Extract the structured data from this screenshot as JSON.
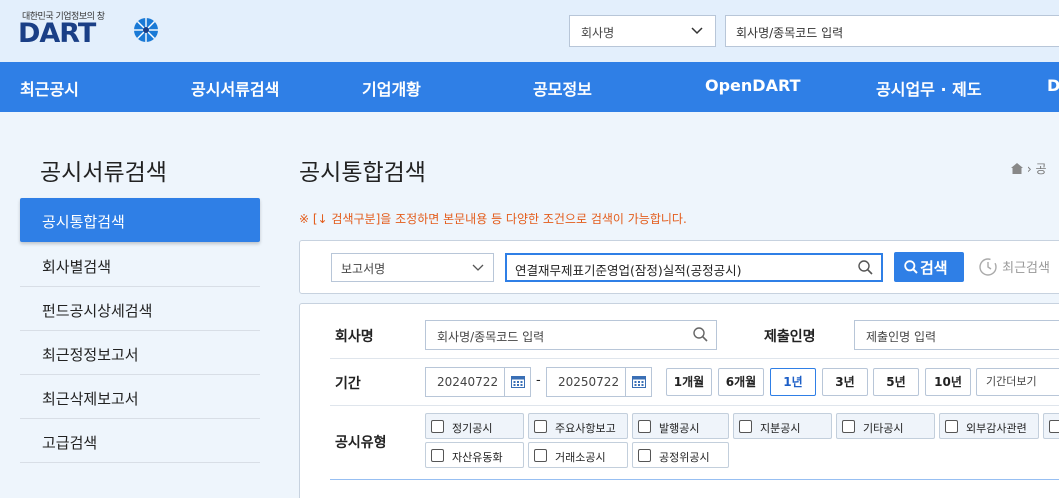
{
  "header": {
    "logo_tagline": "대한민국 기업정보의 창",
    "logo_text": "DART",
    "search_type": "회사명",
    "search_placeholder": "회사명/종목코드 입력"
  },
  "nav": [
    "최근공시",
    "공시서류검색",
    "기업개황",
    "공모정보",
    "OpenDART",
    "공시업무 · 제도",
    "D"
  ],
  "sidebar": {
    "title": "공시서류검색",
    "items": [
      "공시통합검색",
      "회사별검색",
      "펀드공시상세검색",
      "최근정정보고서",
      "최근삭제보고서",
      "고급검색"
    ]
  },
  "main": {
    "title": "공시통합검색",
    "breadcrumb": "공",
    "notice": "※ [↓ 검색구분]을 조정하면 본문내용 등 다양한 조건으로 검색이 가능합니다.",
    "report_select": "보고서명",
    "search_value": "연결재무제표기준영업(잠정)실적(공정공시)",
    "search_button": "검색",
    "recent_search": "최근검색"
  },
  "filters": {
    "company_label": "회사명",
    "company_placeholder": "회사명/종목코드 입력",
    "submitter_label": "제출인명",
    "submitter_placeholder": "제출인명 입력",
    "period_label": "기간",
    "date_from": "20240722",
    "date_sep": "-",
    "date_to": "20250722",
    "period_buttons": [
      "1개월",
      "6개월",
      "1년",
      "3년",
      "5년",
      "10년"
    ],
    "period_more": "기간더보기",
    "type_label": "공시유형",
    "types": [
      "정기공시",
      "주요사항보고",
      "발행공시",
      "지분공시",
      "기타공시",
      "외부감사관련",
      "자산유동화",
      "거래소공시",
      "공정위공시"
    ]
  },
  "colors": {
    "accent": "#2f7fe6",
    "notice": "#e35c1b",
    "logo": "#1a3f86"
  }
}
